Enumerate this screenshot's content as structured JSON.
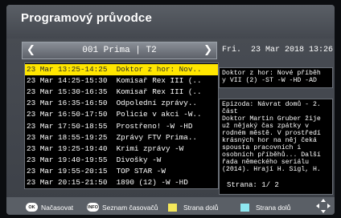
{
  "header": {
    "title": "Programový průvodce"
  },
  "channel": {
    "name": "001 Prima | T2",
    "prev_icon": "chevron-left-icon",
    "next_icon": "chevron-right-icon"
  },
  "datetime": "Fri.  23 Mar 2018 13:26",
  "programs": [
    {
      "text": "23 Mar 13:25-14:25  Doktor z hor: Nov..",
      "selected": true
    },
    {
      "text": "23 Mar 14:25-15:30  Komisař Rex III (..",
      "selected": false
    },
    {
      "text": "23 Mar 15:30-16:35  Komisař Rex III (..",
      "selected": false
    },
    {
      "text": "23 Mar 16:35-16:50  Odpolední zprávy..",
      "selected": false
    },
    {
      "text": "23 Mar 16:50-17:50  Policie v akci -W..",
      "selected": false
    },
    {
      "text": "23 Mar 17:50-18:55  Prostřenо! -W -HD",
      "selected": false
    },
    {
      "text": "23 Mar 18:55-19:25  Zprávy FTV Prima..",
      "selected": false
    },
    {
      "text": "23 Mar 19:25-19:40  Krimi zprávy -W",
      "selected": false
    },
    {
      "text": "23 Mar 19:40-19:55  Divošky -W",
      "selected": false
    },
    {
      "text": "23 Mar 19:55-20:15  TOP STAR -W",
      "selected": false
    },
    {
      "text": "23 Mar 20:15-21:50  1890 (12) -W -HD",
      "selected": false
    }
  ],
  "info_box": "Doktor z hor: Nové příběh\ny VII (2) -ST -W -HD -AD",
  "description": "Epizoda: Návrat domů - 2.\nčást\nDoktor Martin Gruber žije\nuž nějaký čas zpátky v\nrodném městě. V prostředí\nkrásných hor na něj čeká\nspousta pracovních i\nosobních příběhů... Další\nřada německého seriálu\n(2014). Hrají H. Sigl, H.",
  "page_indicator": "Strana:  1/ 2",
  "footer": {
    "ok_badge": "OK",
    "ok_label": "Načasovat",
    "info_badge": "INFO",
    "info_label": "Seznam časovačů",
    "yellow_label": "Strana dolů",
    "cyan_label": "Strana dolů",
    "nav_icon": "dpad-icon"
  },
  "colors": {
    "highlight": "#ffe600",
    "yellow_key": "#f5e85a",
    "cyan_key": "#8ee8f2"
  }
}
